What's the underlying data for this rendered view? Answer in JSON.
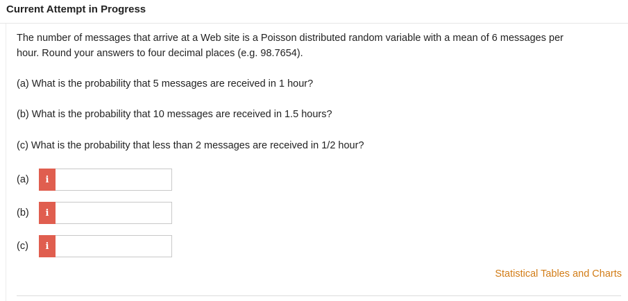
{
  "header": {
    "title": "Current Attempt in Progress"
  },
  "question": {
    "intro_line1": "The number of messages that arrive at a Web site is a Poisson distributed random variable with a mean of 6 messages per",
    "intro_line2": "hour. Round your answers to four decimal places (e.g. 98.7654).",
    "part_a": "(a) What is the probability that 5 messages are received in 1 hour?",
    "part_b": "(b) What is the probability that 10 messages are received in 1.5 hours?",
    "part_c": "(c) What is the probability that less than 2 messages are received in 1/2 hour?"
  },
  "answers": [
    {
      "label": "(a)",
      "icon": "info-icon",
      "icon_glyph": "i",
      "value": ""
    },
    {
      "label": "(b)",
      "icon": "info-icon",
      "icon_glyph": "i",
      "value": ""
    },
    {
      "label": "(c)",
      "icon": "info-icon",
      "icon_glyph": "i",
      "value": ""
    }
  ],
  "footer": {
    "link_label": "Statistical Tables and Charts"
  },
  "colors": {
    "info_badge": "#e05e4f",
    "link": "#d27c16"
  }
}
